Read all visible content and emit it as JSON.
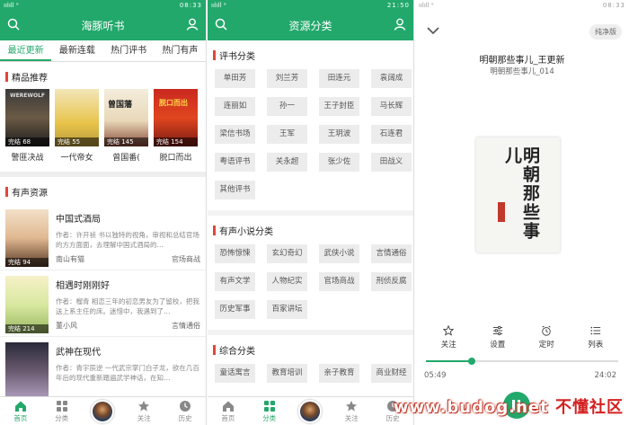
{
  "status_bar": {
    "left_text": "ıılıll ᵊ",
    "panel1_time": "08:33",
    "panel2_time": "21:50",
    "panel3_time": "08:33"
  },
  "panel1": {
    "title": "海豚听书",
    "tabs": [
      "最近更新",
      "最新连载",
      "热门评书",
      "热门有声"
    ],
    "featured_heading": "精品推荐",
    "featured_books": [
      {
        "name": "警匪决战",
        "badge": "完结 68",
        "cover_text": "WEREWOLF"
      },
      {
        "name": "一代帝女",
        "badge": "完结 55",
        "cover_text": ""
      },
      {
        "name": "曾国番(",
        "badge": "完结 145",
        "cover_text": "曾国藩"
      },
      {
        "name": "脱口而出",
        "badge": "完结 154",
        "cover_text": "脱口而出"
      }
    ],
    "audio_heading": "有声资源",
    "audio_list": [
      {
        "title": "中国式酒局",
        "desc": "作者：许开祯 书以独特的视角，审视和总结官场的方方面面，去理解中国式酒局的…",
        "narrator": "南山有猫",
        "category": "官场商战",
        "badge": "完结 94"
      },
      {
        "title": "相遇时刚刚好",
        "desc": "作者：榴青 相恋三年的初恋男友为了留校，把我送上系主任的床。迷惜中，我遇到了…",
        "narrator": "董小风",
        "category": "言情通俗",
        "badge": "完结 214"
      },
      {
        "title": "武神在现代",
        "desc": "作者：青宇辰逆 一代武宗掌门白子龙，欲在几百年后的现代重新踏遍武学神话，在知…",
        "narrator": "",
        "category": "",
        "badge": ""
      }
    ]
  },
  "panel2": {
    "title": "资源分类",
    "sections": [
      {
        "heading": "评书分类",
        "items": [
          "单田芳",
          "刘兰芳",
          "田连元",
          "袁阔成",
          "连丽如",
          "孙一",
          "王子封臣",
          "马长辉",
          "梁信书场",
          "王军",
          "王玥波",
          "石连君",
          "粤语评书",
          "关永超",
          "张少佐",
          "田战义",
          "其他评书"
        ]
      },
      {
        "heading": "有声小说分类",
        "items": [
          "恐怖惊悚",
          "玄幻奇幻",
          "武侠小说",
          "言情通俗",
          "有声文学",
          "人物纪实",
          "官场商战",
          "刑侦反腐",
          "历史军事",
          "百家讲坛"
        ]
      },
      {
        "heading": "综合分类",
        "items": [
          "童话寓言",
          "教育培训",
          "亲子教育",
          "商业财经"
        ]
      }
    ]
  },
  "panel3": {
    "pure_label": "纯净版",
    "track_title": "明朝那些事儿_王更新",
    "track_sub": "明朝那些事儿_014",
    "cover_text": "明朝那些事儿",
    "controls": [
      {
        "icon": "star-icon",
        "label": "关注"
      },
      {
        "icon": "settings-sliders-icon",
        "label": "设置"
      },
      {
        "icon": "alarm-clock-icon",
        "label": "定时"
      },
      {
        "icon": "list-icon",
        "label": "列表"
      }
    ],
    "current_time": "05:49",
    "total_time": "24:02",
    "progress": 0.24
  },
  "bottom_nav": [
    "首页",
    "分类",
    "",
    "关注",
    "历史"
  ],
  "watermark": {
    "part1": "www.budog.net",
    "part2": "不懂社区"
  },
  "colors": {
    "accent": "#22a86b",
    "section_bar": "#e0463b"
  }
}
